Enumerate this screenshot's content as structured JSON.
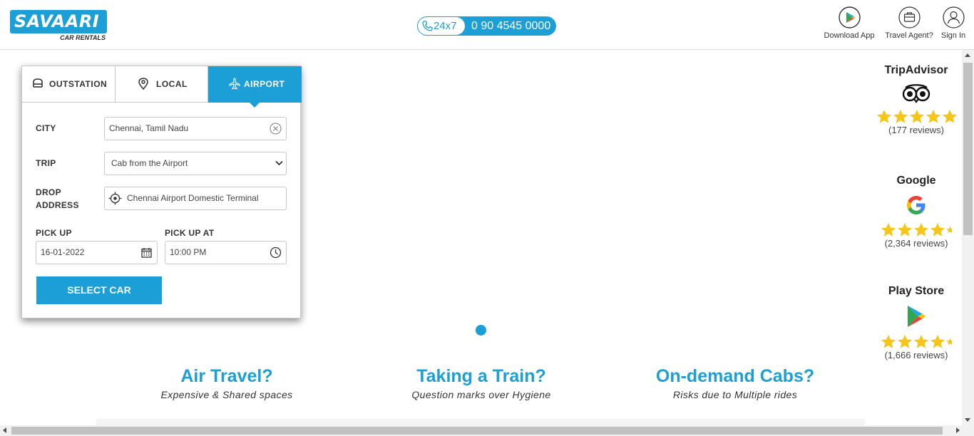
{
  "header": {
    "logo_main": "SAVAARI",
    "logo_sub": "CAR RENTALS",
    "support_label": "24x7",
    "phone": "0 90 4545 0000",
    "download_label": "Download App",
    "agent_label": "Travel Agent?",
    "signin_label": "Sign In"
  },
  "booking": {
    "tabs": [
      {
        "label": "OUTSTATION",
        "icon": "car-front-icon"
      },
      {
        "label": "LOCAL",
        "icon": "location-pin-icon"
      },
      {
        "label": "AIRPORT",
        "icon": "airplane-icon",
        "active": true
      }
    ],
    "city_label": "CITY",
    "city_value": "Chennai, Tamil Nadu",
    "trip_label": "TRIP",
    "trip_value": "Cab from the Airport",
    "drop_label_1": "DROP",
    "drop_label_2": "ADDRESS",
    "drop_value": "Chennai Airport Domestic Terminal",
    "pickup_label": "PICK UP",
    "pickup_date": "16-01-2022",
    "pickup_at_label": "PICK UP AT",
    "pickup_time": "10:00 PM",
    "submit_label": "SELECT CAR"
  },
  "features": [
    {
      "title": "Air Travel?",
      "subtitle": "Expensive & Shared spaces"
    },
    {
      "title": "Taking a Train?",
      "subtitle": "Question marks over Hygiene"
    },
    {
      "title": "On-demand Cabs?",
      "subtitle": "Risks due to Multiple rides"
    }
  ],
  "ratings": [
    {
      "name": "TripAdvisor",
      "stars": 5,
      "reviews": "(177 reviews)"
    },
    {
      "name": "Google",
      "stars": 4.5,
      "reviews": "(2,364 reviews)"
    },
    {
      "name": "Play Store",
      "stars": 4.5,
      "reviews": "(1,666 reviews)"
    }
  ],
  "colors": {
    "accent": "#1c9fd7",
    "star": "#f5c518"
  }
}
